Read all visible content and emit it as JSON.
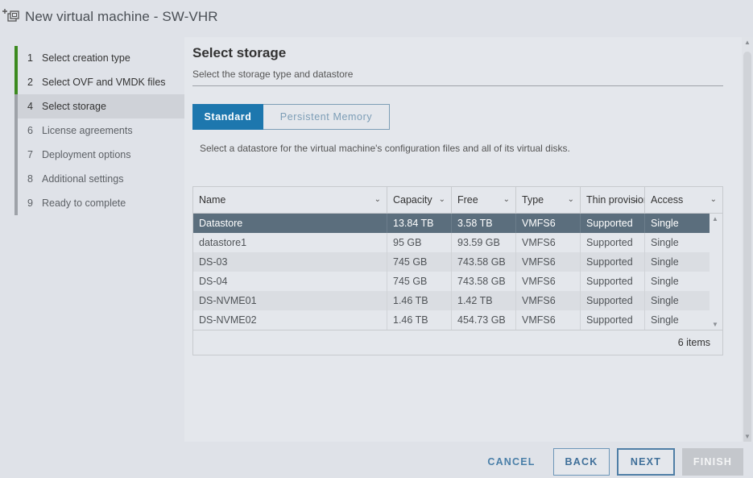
{
  "window": {
    "title": "New virtual machine - SW-VHR",
    "icon": "new-vm-icon"
  },
  "sidebar": {
    "steps": [
      {
        "num": "1",
        "label": "Select creation type",
        "state": "done"
      },
      {
        "num": "2",
        "label": "Select OVF and VMDK files",
        "state": "done"
      },
      {
        "num": "4",
        "label": "Select storage",
        "state": "current"
      },
      {
        "num": "6",
        "label": "License agreements",
        "state": "pending"
      },
      {
        "num": "7",
        "label": "Deployment options",
        "state": "pending"
      },
      {
        "num": "8",
        "label": "Additional settings",
        "state": "pending"
      },
      {
        "num": "9",
        "label": "Ready to complete",
        "state": "pending"
      }
    ]
  },
  "main": {
    "heading": "Select storage",
    "subtitle": "Select the storage type and datastore",
    "tabs": [
      {
        "label": "Standard",
        "active": true
      },
      {
        "label": "Persistent Memory",
        "active": false
      }
    ],
    "description": "Select a datastore for the virtual machine's configuration files and all of its virtual disks.",
    "table": {
      "columns": [
        "Name",
        "Capacity",
        "Free",
        "Type",
        "Thin provisioning",
        "Access"
      ],
      "rows": [
        [
          "Datastore",
          "13.84 TB",
          "3.58 TB",
          "VMFS6",
          "Supported",
          "Single"
        ],
        [
          "datastore1",
          "95 GB",
          "93.59 GB",
          "VMFS6",
          "Supported",
          "Single"
        ],
        [
          "DS-03",
          "745 GB",
          "743.58 GB",
          "VMFS6",
          "Supported",
          "Single"
        ],
        [
          "DS-04",
          "745 GB",
          "743.58 GB",
          "VMFS6",
          "Supported",
          "Single"
        ],
        [
          "DS-NVME01",
          "1.46 TB",
          "1.42 TB",
          "VMFS6",
          "Supported",
          "Single"
        ],
        [
          "DS-NVME02",
          "1.46 TB",
          "454.73 GB",
          "VMFS6",
          "Supported",
          "Single"
        ]
      ],
      "selected_row": 0,
      "footer_count": "6 items"
    }
  },
  "footer": {
    "cancel": "CANCEL",
    "back": "BACK",
    "next": "NEXT",
    "finish": "FINISH"
  },
  "colors": {
    "accent": "#1d77ae",
    "step_done": "#3c8a1f",
    "selected_row": "#5b6e7d"
  }
}
